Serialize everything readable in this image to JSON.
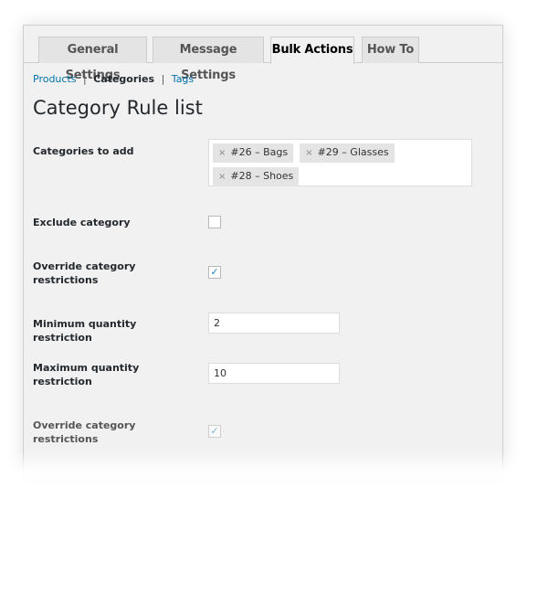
{
  "tabs": [
    {
      "label": "General Settings"
    },
    {
      "label": "Message Settings"
    },
    {
      "label": "Bulk Actions",
      "active": true
    },
    {
      "label": "How To"
    }
  ],
  "subnav": {
    "products": "Products",
    "categories": "Categories",
    "tags": "Tags",
    "sep": "|"
  },
  "title": "Category Rule list",
  "fields": {
    "categories_label": "Categories to add",
    "categories": [
      "#26 – Bags",
      "#29 – Glasses",
      "#28 – Shoes"
    ],
    "exclude_label": "Exclude category",
    "exclude_checked": false,
    "override_label": "Override category restrictions",
    "override_checked": true,
    "min_label": "Minimum quantity restriction",
    "min_value": "2",
    "max_label": "Maximum quantity restriction",
    "max_value": "10",
    "override2_label": "Override category restrictions",
    "override2_checked": true
  },
  "icons": {
    "remove": "×",
    "check": "✓"
  },
  "colors": {
    "link": "#0073aa",
    "check": "#1e8cbe"
  }
}
